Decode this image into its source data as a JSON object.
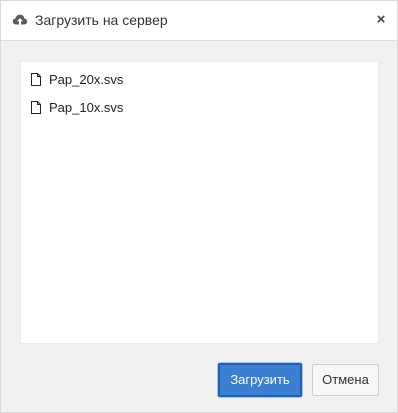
{
  "dialog": {
    "title": "Загрузить на сервер",
    "title_icon": "cloud-upload-icon",
    "close_symbol": "×"
  },
  "files": [
    {
      "name": "Pap_20x.svs",
      "icon": "file-icon"
    },
    {
      "name": "Pap_10x.svs",
      "icon": "file-icon"
    }
  ],
  "buttons": {
    "upload_label": "Загрузить",
    "cancel_label": "Отмена"
  },
  "colors": {
    "primary": "#3a7fd1",
    "primary_border": "#1f5fae",
    "body_bg": "#f1f1f1"
  }
}
